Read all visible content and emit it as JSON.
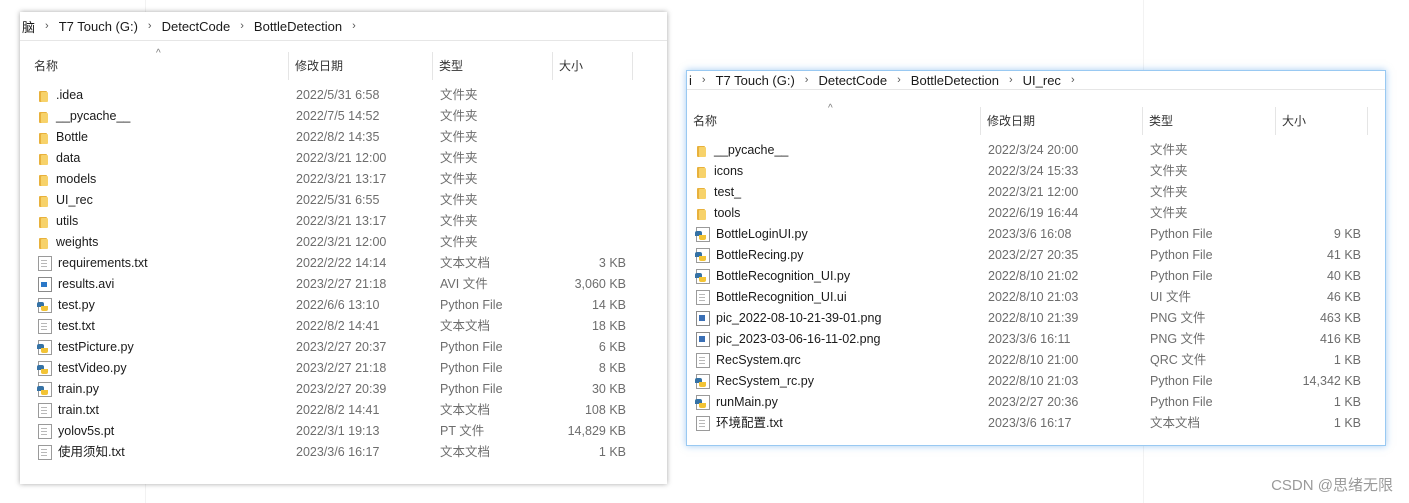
{
  "left": {
    "breadcrumb": [
      "脑",
      "T7 Touch (G:)",
      "DetectCode",
      "BottleDetection"
    ],
    "columns": {
      "name": "名称",
      "date": "修改日期",
      "type": "类型",
      "size": "大小"
    },
    "files": [
      {
        "name": ".idea",
        "date": "2022/5/31 6:58",
        "type": "文件夹",
        "size": "",
        "icon": "folder-icon"
      },
      {
        "name": "__pycache__",
        "date": "2022/7/5 14:52",
        "type": "文件夹",
        "size": "",
        "icon": "folder-icon"
      },
      {
        "name": "Bottle",
        "date": "2022/8/2 14:35",
        "type": "文件夹",
        "size": "",
        "icon": "folder-icon"
      },
      {
        "name": "data",
        "date": "2022/3/21 12:00",
        "type": "文件夹",
        "size": "",
        "icon": "folder-icon"
      },
      {
        "name": "models",
        "date": "2022/3/21 13:17",
        "type": "文件夹",
        "size": "",
        "icon": "folder-icon"
      },
      {
        "name": "UI_rec",
        "date": "2022/5/31 6:55",
        "type": "文件夹",
        "size": "",
        "icon": "folder-icon"
      },
      {
        "name": "utils",
        "date": "2022/3/21 13:17",
        "type": "文件夹",
        "size": "",
        "icon": "folder-icon"
      },
      {
        "name": "weights",
        "date": "2022/3/21 12:00",
        "type": "文件夹",
        "size": "",
        "icon": "folder-icon"
      },
      {
        "name": "requirements.txt",
        "date": "2022/2/22 14:14",
        "type": "文本文档",
        "size": "3 KB",
        "icon": "text-file-icon"
      },
      {
        "name": "results.avi",
        "date": "2023/2/27 21:18",
        "type": "AVI 文件",
        "size": "3,060 KB",
        "icon": "video-file-icon"
      },
      {
        "name": "test.py",
        "date": "2022/6/6 13:10",
        "type": "Python File",
        "size": "14 KB",
        "icon": "python-file-icon"
      },
      {
        "name": "test.txt",
        "date": "2022/8/2 14:41",
        "type": "文本文档",
        "size": "18 KB",
        "icon": "text-file-icon"
      },
      {
        "name": "testPicture.py",
        "date": "2023/2/27 20:37",
        "type": "Python File",
        "size": "6 KB",
        "icon": "python-file-icon"
      },
      {
        "name": "testVideo.py",
        "date": "2023/2/27 21:18",
        "type": "Python File",
        "size": "8 KB",
        "icon": "python-file-icon"
      },
      {
        "name": "train.py",
        "date": "2023/2/27 20:39",
        "type": "Python File",
        "size": "30 KB",
        "icon": "python-file-icon"
      },
      {
        "name": "train.txt",
        "date": "2022/8/2 14:41",
        "type": "文本文档",
        "size": "108 KB",
        "icon": "text-file-icon"
      },
      {
        "name": "yolov5s.pt",
        "date": "2022/3/1 19:13",
        "type": "PT 文件",
        "size": "14,829 KB",
        "icon": "generic-file-icon"
      },
      {
        "name": "使用须知.txt",
        "date": "2023/3/6 16:17",
        "type": "文本文档",
        "size": "1 KB",
        "icon": "text-file-icon"
      }
    ]
  },
  "right": {
    "breadcrumb": [
      "i",
      "T7 Touch (G:)",
      "DetectCode",
      "BottleDetection",
      "UI_rec"
    ],
    "columns": {
      "name": "名称",
      "date": "修改日期",
      "type": "类型",
      "size": "大小"
    },
    "files": [
      {
        "name": "__pycache__",
        "date": "2022/3/24 20:00",
        "type": "文件夹",
        "size": "",
        "icon": "folder-icon"
      },
      {
        "name": "icons",
        "date": "2022/3/24 15:33",
        "type": "文件夹",
        "size": "",
        "icon": "folder-icon"
      },
      {
        "name": "test_",
        "date": "2022/3/21 12:00",
        "type": "文件夹",
        "size": "",
        "icon": "folder-icon"
      },
      {
        "name": "tools",
        "date": "2022/6/19 16:44",
        "type": "文件夹",
        "size": "",
        "icon": "folder-icon"
      },
      {
        "name": "BottleLoginUI.py",
        "date": "2023/3/6 16:08",
        "type": "Python File",
        "size": "9 KB",
        "icon": "python-file-icon"
      },
      {
        "name": "BottleRecing.py",
        "date": "2023/2/27 20:35",
        "type": "Python File",
        "size": "41 KB",
        "icon": "python-file-icon"
      },
      {
        "name": "BottleRecognition_UI.py",
        "date": "2022/8/10 21:02",
        "type": "Python File",
        "size": "40 KB",
        "icon": "python-file-icon"
      },
      {
        "name": "BottleRecognition_UI.ui",
        "date": "2022/8/10 21:03",
        "type": "UI 文件",
        "size": "46 KB",
        "icon": "generic-file-icon"
      },
      {
        "name": "pic_2022-08-10-21-39-01.png",
        "date": "2022/8/10 21:39",
        "type": "PNG 文件",
        "size": "463 KB",
        "icon": "image-file-icon"
      },
      {
        "name": "pic_2023-03-06-16-11-02.png",
        "date": "2023/3/6 16:11",
        "type": "PNG 文件",
        "size": "416 KB",
        "icon": "image-file-icon"
      },
      {
        "name": "RecSystem.qrc",
        "date": "2022/8/10 21:00",
        "type": "QRC 文件",
        "size": "1 KB",
        "icon": "generic-file-icon"
      },
      {
        "name": "RecSystem_rc.py",
        "date": "2022/8/10 21:03",
        "type": "Python File",
        "size": "14,342 KB",
        "icon": "python-file-icon"
      },
      {
        "name": "runMain.py",
        "date": "2023/2/27 20:36",
        "type": "Python File",
        "size": "1 KB",
        "icon": "python-file-icon"
      },
      {
        "name": "环境配置.txt",
        "date": "2023/3/6 16:17",
        "type": "文本文档",
        "size": "1 KB",
        "icon": "text-file-icon"
      }
    ]
  },
  "watermark": "CSDN @思绪无限"
}
